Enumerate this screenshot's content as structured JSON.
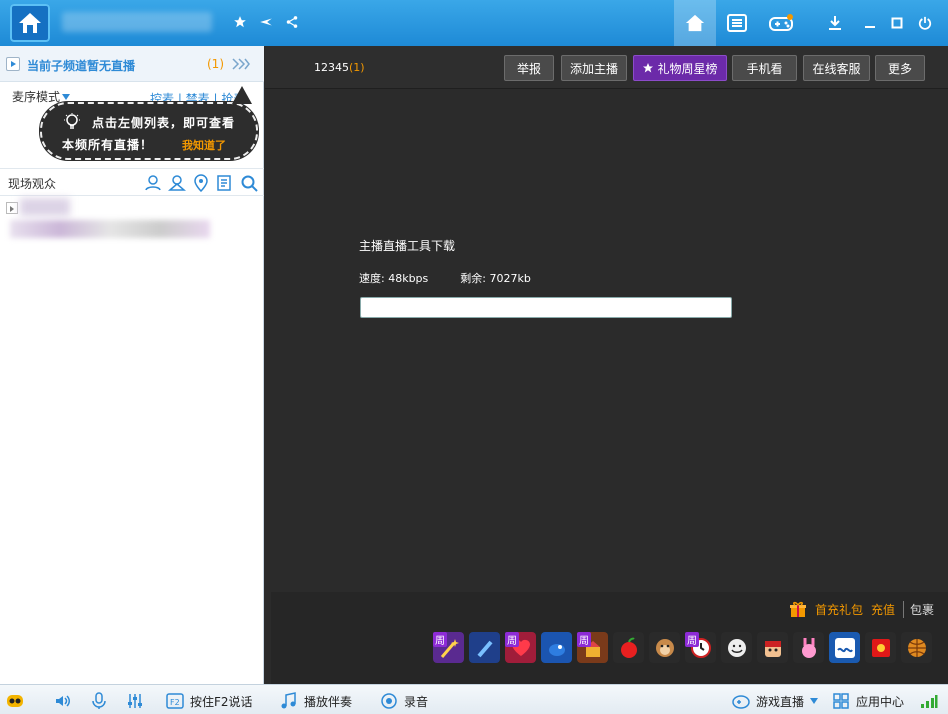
{
  "titlebar": {
    "icons": [
      "home-logo-icon",
      "star-icon",
      "plane-icon",
      "share-icon"
    ],
    "nav": [
      "home-icon",
      "list-icon",
      "gamepad-icon"
    ],
    "window": [
      "download-icon",
      "minimize-icon",
      "maximize-icon",
      "power-icon"
    ]
  },
  "left": {
    "subchannel": "当前子频道暂无直播",
    "subchannel_count": "(1)",
    "mode_label": "麦序模式",
    "mode_links": "控麦 | 禁麦 | 抢麦",
    "tip_line1": "点击左侧列表，即可查看",
    "tip_line2": "本频所有直播！",
    "tip_ok": "我知道了",
    "audience_label": "现场观众"
  },
  "main": {
    "room_id": "12345",
    "room_count": "(1)",
    "buttons": {
      "report": "举报",
      "add_host": "添加主播",
      "gift_rank": "礼物周星榜",
      "mobile": "手机看",
      "service": "在线客服",
      "more": "更多"
    },
    "download_title": "主播直播工具下载",
    "speed": "速度: 48kbps",
    "remaining": "剩余: 7027kb",
    "progress": 0.0,
    "gift_first": "首充礼包",
    "gift_charge": "充值",
    "gift_bag": "包裹",
    "gift_badge": "周"
  },
  "bottombar": {
    "f2": "按住F2说话",
    "accompany": "播放伴奏",
    "record": "录音",
    "game_live": "游戏直播",
    "app_center": "应用中心"
  }
}
